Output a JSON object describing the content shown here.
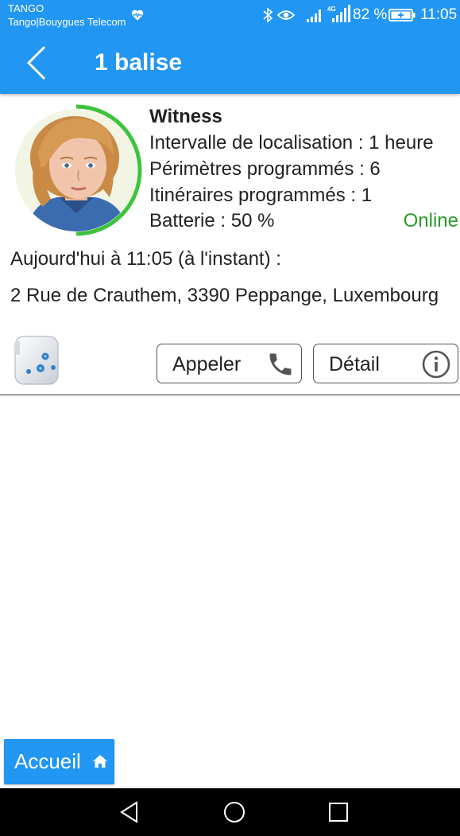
{
  "status_bar": {
    "carrier_line1": "TANGO",
    "carrier_line2": "Tango|Bouygues Telecom",
    "battery_percent": "82 %",
    "time": "11:05",
    "icons": [
      "heart-monitor-icon",
      "bluetooth-icon",
      "eye-icon",
      "signal-icon",
      "lte-signal-icon",
      "battery-charging-icon"
    ]
  },
  "app_bar": {
    "title": "1 balise",
    "back_icon": "chevron-left-icon"
  },
  "device": {
    "name": "Witness",
    "interval": "Intervalle de localisation : 1 heure",
    "perimeters": "Périmètres programmés : 6",
    "itineraries": "Itinéraires programmés : 1",
    "battery": "Batterie : 50 %",
    "battery_level": 0.5,
    "status": "Online",
    "last_seen": "Aujourd'hui à 11:05 (à l'instant) :",
    "address": "2 Rue de Crauthem, 3390 Peppange, Luxembourg"
  },
  "actions": {
    "call_label": "Appeler",
    "detail_label": "Détail"
  },
  "home_button": {
    "label": "Accueil"
  },
  "colors": {
    "primary": "#2196F3",
    "online": "#2a9a2a",
    "battery_ring": "#3cc43c"
  }
}
